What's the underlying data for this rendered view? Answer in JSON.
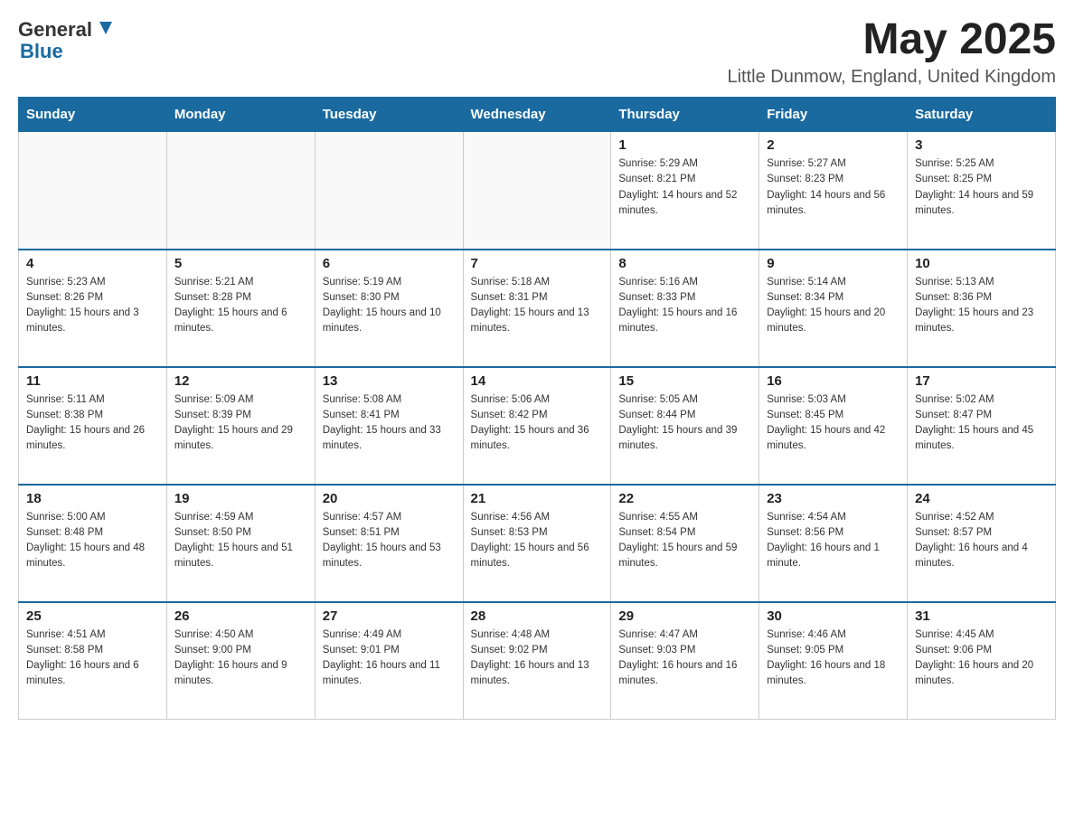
{
  "header": {
    "logo_general": "General",
    "logo_blue": "Blue",
    "month": "May 2025",
    "location": "Little Dunmow, England, United Kingdom"
  },
  "weekdays": [
    "Sunday",
    "Monday",
    "Tuesday",
    "Wednesday",
    "Thursday",
    "Friday",
    "Saturday"
  ],
  "weeks": [
    [
      {
        "day": "",
        "sunrise": "",
        "sunset": "",
        "daylight": ""
      },
      {
        "day": "",
        "sunrise": "",
        "sunset": "",
        "daylight": ""
      },
      {
        "day": "",
        "sunrise": "",
        "sunset": "",
        "daylight": ""
      },
      {
        "day": "",
        "sunrise": "",
        "sunset": "",
        "daylight": ""
      },
      {
        "day": "1",
        "sunrise": "Sunrise: 5:29 AM",
        "sunset": "Sunset: 8:21 PM",
        "daylight": "Daylight: 14 hours and 52 minutes."
      },
      {
        "day": "2",
        "sunrise": "Sunrise: 5:27 AM",
        "sunset": "Sunset: 8:23 PM",
        "daylight": "Daylight: 14 hours and 56 minutes."
      },
      {
        "day": "3",
        "sunrise": "Sunrise: 5:25 AM",
        "sunset": "Sunset: 8:25 PM",
        "daylight": "Daylight: 14 hours and 59 minutes."
      }
    ],
    [
      {
        "day": "4",
        "sunrise": "Sunrise: 5:23 AM",
        "sunset": "Sunset: 8:26 PM",
        "daylight": "Daylight: 15 hours and 3 minutes."
      },
      {
        "day": "5",
        "sunrise": "Sunrise: 5:21 AM",
        "sunset": "Sunset: 8:28 PM",
        "daylight": "Daylight: 15 hours and 6 minutes."
      },
      {
        "day": "6",
        "sunrise": "Sunrise: 5:19 AM",
        "sunset": "Sunset: 8:30 PM",
        "daylight": "Daylight: 15 hours and 10 minutes."
      },
      {
        "day": "7",
        "sunrise": "Sunrise: 5:18 AM",
        "sunset": "Sunset: 8:31 PM",
        "daylight": "Daylight: 15 hours and 13 minutes."
      },
      {
        "day": "8",
        "sunrise": "Sunrise: 5:16 AM",
        "sunset": "Sunset: 8:33 PM",
        "daylight": "Daylight: 15 hours and 16 minutes."
      },
      {
        "day": "9",
        "sunrise": "Sunrise: 5:14 AM",
        "sunset": "Sunset: 8:34 PM",
        "daylight": "Daylight: 15 hours and 20 minutes."
      },
      {
        "day": "10",
        "sunrise": "Sunrise: 5:13 AM",
        "sunset": "Sunset: 8:36 PM",
        "daylight": "Daylight: 15 hours and 23 minutes."
      }
    ],
    [
      {
        "day": "11",
        "sunrise": "Sunrise: 5:11 AM",
        "sunset": "Sunset: 8:38 PM",
        "daylight": "Daylight: 15 hours and 26 minutes."
      },
      {
        "day": "12",
        "sunrise": "Sunrise: 5:09 AM",
        "sunset": "Sunset: 8:39 PM",
        "daylight": "Daylight: 15 hours and 29 minutes."
      },
      {
        "day": "13",
        "sunrise": "Sunrise: 5:08 AM",
        "sunset": "Sunset: 8:41 PM",
        "daylight": "Daylight: 15 hours and 33 minutes."
      },
      {
        "day": "14",
        "sunrise": "Sunrise: 5:06 AM",
        "sunset": "Sunset: 8:42 PM",
        "daylight": "Daylight: 15 hours and 36 minutes."
      },
      {
        "day": "15",
        "sunrise": "Sunrise: 5:05 AM",
        "sunset": "Sunset: 8:44 PM",
        "daylight": "Daylight: 15 hours and 39 minutes."
      },
      {
        "day": "16",
        "sunrise": "Sunrise: 5:03 AM",
        "sunset": "Sunset: 8:45 PM",
        "daylight": "Daylight: 15 hours and 42 minutes."
      },
      {
        "day": "17",
        "sunrise": "Sunrise: 5:02 AM",
        "sunset": "Sunset: 8:47 PM",
        "daylight": "Daylight: 15 hours and 45 minutes."
      }
    ],
    [
      {
        "day": "18",
        "sunrise": "Sunrise: 5:00 AM",
        "sunset": "Sunset: 8:48 PM",
        "daylight": "Daylight: 15 hours and 48 minutes."
      },
      {
        "day": "19",
        "sunrise": "Sunrise: 4:59 AM",
        "sunset": "Sunset: 8:50 PM",
        "daylight": "Daylight: 15 hours and 51 minutes."
      },
      {
        "day": "20",
        "sunrise": "Sunrise: 4:57 AM",
        "sunset": "Sunset: 8:51 PM",
        "daylight": "Daylight: 15 hours and 53 minutes."
      },
      {
        "day": "21",
        "sunrise": "Sunrise: 4:56 AM",
        "sunset": "Sunset: 8:53 PM",
        "daylight": "Daylight: 15 hours and 56 minutes."
      },
      {
        "day": "22",
        "sunrise": "Sunrise: 4:55 AM",
        "sunset": "Sunset: 8:54 PM",
        "daylight": "Daylight: 15 hours and 59 minutes."
      },
      {
        "day": "23",
        "sunrise": "Sunrise: 4:54 AM",
        "sunset": "Sunset: 8:56 PM",
        "daylight": "Daylight: 16 hours and 1 minute."
      },
      {
        "day": "24",
        "sunrise": "Sunrise: 4:52 AM",
        "sunset": "Sunset: 8:57 PM",
        "daylight": "Daylight: 16 hours and 4 minutes."
      }
    ],
    [
      {
        "day": "25",
        "sunrise": "Sunrise: 4:51 AM",
        "sunset": "Sunset: 8:58 PM",
        "daylight": "Daylight: 16 hours and 6 minutes."
      },
      {
        "day": "26",
        "sunrise": "Sunrise: 4:50 AM",
        "sunset": "Sunset: 9:00 PM",
        "daylight": "Daylight: 16 hours and 9 minutes."
      },
      {
        "day": "27",
        "sunrise": "Sunrise: 4:49 AM",
        "sunset": "Sunset: 9:01 PM",
        "daylight": "Daylight: 16 hours and 11 minutes."
      },
      {
        "day": "28",
        "sunrise": "Sunrise: 4:48 AM",
        "sunset": "Sunset: 9:02 PM",
        "daylight": "Daylight: 16 hours and 13 minutes."
      },
      {
        "day": "29",
        "sunrise": "Sunrise: 4:47 AM",
        "sunset": "Sunset: 9:03 PM",
        "daylight": "Daylight: 16 hours and 16 minutes."
      },
      {
        "day": "30",
        "sunrise": "Sunrise: 4:46 AM",
        "sunset": "Sunset: 9:05 PM",
        "daylight": "Daylight: 16 hours and 18 minutes."
      },
      {
        "day": "31",
        "sunrise": "Sunrise: 4:45 AM",
        "sunset": "Sunset: 9:06 PM",
        "daylight": "Daylight: 16 hours and 20 minutes."
      }
    ]
  ]
}
